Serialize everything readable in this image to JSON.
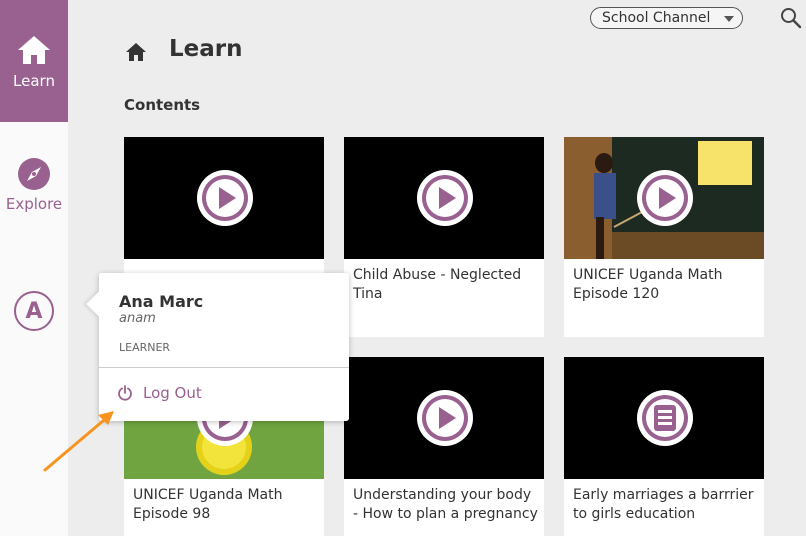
{
  "sidebar": {
    "learn_label": "Learn",
    "explore_label": "Explore",
    "account_initial": "A"
  },
  "topbar": {
    "channel_selected": "School Channel"
  },
  "header": {
    "title": "Learn",
    "section": "Contents"
  },
  "cards": [
    {
      "title": "",
      "kind": "video"
    },
    {
      "title": "Child Abuse - Neglected Tina",
      "kind": "video"
    },
    {
      "title": "UNICEF Uganda Math Episode 120",
      "kind": "video"
    },
    {
      "title": "UNICEF Uganda Math Episode 98",
      "kind": "video"
    },
    {
      "title": "Understanding your body - How to plan a pregnancy",
      "kind": "video"
    },
    {
      "title": "Early marriages a barrrier to girls education",
      "kind": "document"
    }
  ],
  "user_menu": {
    "name": "Ana Marc",
    "username": "anam",
    "role": "LEARNER",
    "logout_label": "Log Out"
  },
  "colors": {
    "accent": "#996190",
    "annotation_arrow": "#f7931e"
  }
}
